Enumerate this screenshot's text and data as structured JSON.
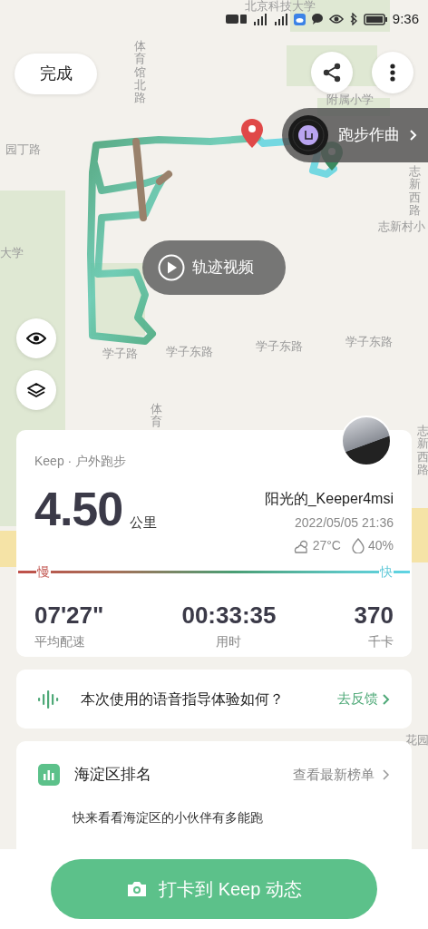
{
  "status_bar": {
    "time": "9:36"
  },
  "top_bar": {
    "done_button": "完成"
  },
  "map": {
    "labels": [
      {
        "text": "北京科技大学",
        "kind": "horizontal"
      },
      {
        "text": "体育馆北路",
        "kind": "vertical"
      },
      {
        "text": "园丁路",
        "kind": "horizontal"
      },
      {
        "text": "附属小学",
        "kind": "horizontal"
      },
      {
        "text": "志新西路",
        "kind": "vertical"
      },
      {
        "text": "志新村小",
        "kind": "horizontal"
      },
      {
        "text": "大学",
        "kind": "horizontal"
      },
      {
        "text": "学子路",
        "kind": "horizontal"
      },
      {
        "text": "学子东路",
        "kind": "horizontal"
      },
      {
        "text": "学子东路",
        "kind": "horizontal"
      },
      {
        "text": "学子东路",
        "kind": "horizontal"
      },
      {
        "text": "体育",
        "kind": "vertical"
      },
      {
        "text": "志新西路",
        "kind": "vertical"
      },
      {
        "text": "花园",
        "kind": "horizontal"
      }
    ],
    "music_button": "跑步作曲",
    "video_button": "轨迹视频"
  },
  "summary": {
    "source": "Keep · 户外跑步",
    "distance": "4.50",
    "unit": "公里",
    "user": "阳光的_Keeper4msi",
    "datetime": "2022/05/05 21:36",
    "temperature": "27°C",
    "humidity": "40%",
    "pace_slow": "慢",
    "pace_fast": "快",
    "stats": [
      {
        "value": "07'27\"",
        "label": "平均配速"
      },
      {
        "value": "00:33:35",
        "label": "用时"
      },
      {
        "value": "370",
        "label": "千卡"
      }
    ]
  },
  "feedback": {
    "question": "本次使用的语音指导体验如何？",
    "action": "去反馈"
  },
  "ranking": {
    "title": "海淀区排名",
    "link": "查看最新榜单",
    "description": "快来看看海淀区的小伙伴有多能跑"
  },
  "share_button": "打卡到 Keep 动态"
}
